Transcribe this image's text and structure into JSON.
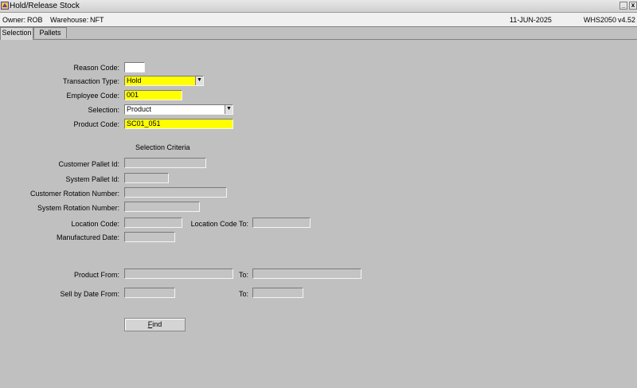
{
  "window": {
    "title": "Hold/Release Stock",
    "minimize_label": "_",
    "close_label": "x"
  },
  "info": {
    "owner_label": "Owner:",
    "owner_value": "ROB",
    "warehouse_label": "Warehouse:",
    "warehouse_value": "NFT",
    "date": "11-JUN-2025",
    "program": "WHS2050",
    "version": "v4.52"
  },
  "tabs": [
    {
      "label": "Selection",
      "active": true
    },
    {
      "label": "Pallets",
      "active": false
    }
  ],
  "form": {
    "reason_code": {
      "label": "Reason Code:",
      "value": ""
    },
    "transaction_type": {
      "label": "Transaction Type:",
      "value": "Hold"
    },
    "employee_code": {
      "label": "Employee Code:",
      "value": "001"
    },
    "selection": {
      "label": "Selection:",
      "value": "Product"
    },
    "product_code": {
      "label": "Product Code:",
      "value": "SC01_051"
    },
    "criteria_heading": "Selection Criteria",
    "customer_pallet_id": {
      "label": "Customer Pallet Id:",
      "value": ""
    },
    "system_pallet_id": {
      "label": "System Pallet Id:",
      "value": ""
    },
    "customer_rotation_number": {
      "label": "Customer Rotation Number:",
      "value": ""
    },
    "system_rotation_number": {
      "label": "System Rotation Number:",
      "value": ""
    },
    "location_code": {
      "label": "Location Code:",
      "value": ""
    },
    "location_code_to": {
      "label": "Location Code To:",
      "value": ""
    },
    "manufactured_date": {
      "label": "Manufactured Date:",
      "value": ""
    },
    "product_from": {
      "label": "Product From:",
      "value": ""
    },
    "product_to": {
      "label": "To:",
      "value": ""
    },
    "sell_by_date_from": {
      "label": "Sell by Date From:",
      "value": ""
    },
    "sell_by_date_to": {
      "label": "To:",
      "value": ""
    },
    "find_label_prefix": "",
    "find_label_accel": "F",
    "find_label_rest": "ind"
  },
  "colors": {
    "background": "#c0c0c0",
    "mandatory": "#ffff00",
    "editable": "#ffffff"
  },
  "icons": {
    "app": "warehouse-app-icon",
    "dropdown": "chevron-down-icon"
  }
}
